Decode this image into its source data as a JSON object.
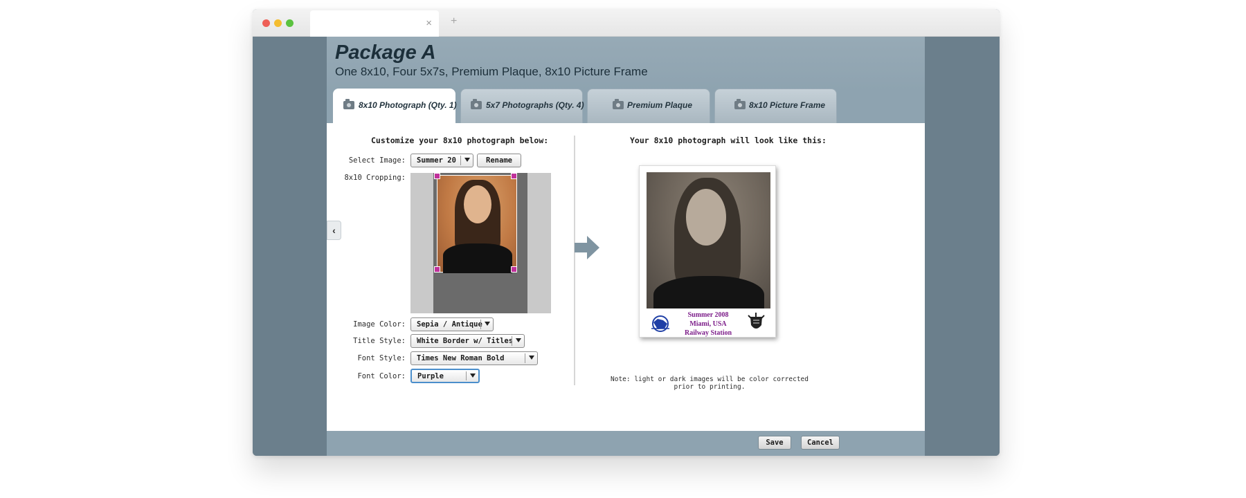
{
  "browser": {
    "tab_close": "×",
    "new_tab": "+"
  },
  "package": {
    "title": "Package A",
    "subtitle": "One 8x10, Four 5x7s, Premium Plaque, 8x10 Picture Frame"
  },
  "tabs": [
    {
      "label": "8x10 Photograph (Qty. 1)",
      "active": true
    },
    {
      "label": "5x7 Photographs (Qty. 4)",
      "active": false
    },
    {
      "label": "Premium Plaque",
      "active": false
    },
    {
      "label": "8x10 Picture Frame",
      "active": false
    }
  ],
  "customize": {
    "heading": "Customize your 8x10 photograph below:",
    "select_image_label": "Select Image:",
    "select_image_value": "Summer 20",
    "rename_label": "Rename",
    "cropping_label": "8x10 Cropping:",
    "image_color_label": "Image Color:",
    "image_color_value": "Sepia / Antique",
    "title_style_label": "Title Style:",
    "title_style_value": "White Border w/ Titles",
    "font_style_label": "Font Style:",
    "font_style_value": "Times New Roman Bold",
    "font_color_label": "Font Color:",
    "font_color_value": "Purple",
    "nav_prev": "‹"
  },
  "preview": {
    "heading": "Your 8x10 photograph will look like this:",
    "title_lines": [
      "Summer 2008",
      "Miami, USA",
      "Railway Station"
    ],
    "title_color": "#7d1e8a",
    "note": "Note: light or dark images will be color corrected prior to printing."
  },
  "footer": {
    "save_label": "Save",
    "cancel_label": "Cancel"
  },
  "colors": {
    "panel": "#8ea3b0",
    "background": "#6b7f8c",
    "crop_handle": "#c0319b",
    "focus": "#4a8ecb"
  }
}
